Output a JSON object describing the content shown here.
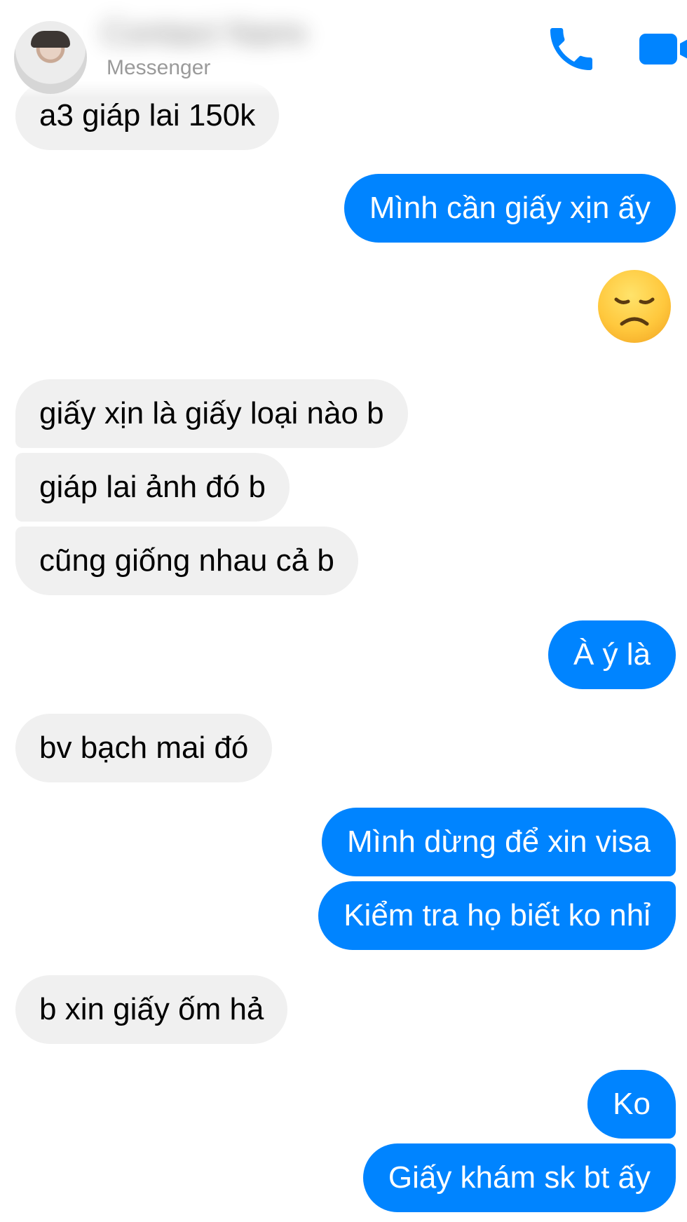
{
  "header": {
    "contact_name": "Contact Name",
    "subtitle": "Messenger",
    "icons": [
      "phone-icon",
      "video-camera-icon"
    ],
    "accent_color": "#0084ff"
  },
  "messages": [
    {
      "side": "in",
      "text": "a3 giáp lai 150k"
    },
    {
      "side": "out",
      "text": "Mình cần giấy xịn ấy"
    },
    {
      "side": "out",
      "emoji": "disappointed-face"
    },
    {
      "side": "in",
      "text": "giấy xịn là giấy loại nào b"
    },
    {
      "side": "in",
      "text": "giáp lai ảnh đó b"
    },
    {
      "side": "in",
      "text": "cũng giống nhau cả b"
    },
    {
      "side": "out",
      "text": "À ý là"
    },
    {
      "side": "in",
      "text": "bv bạch mai đó"
    },
    {
      "side": "out",
      "text": "Mình dừng để xin visa"
    },
    {
      "side": "out",
      "text": "Kiểm tra họ biết ko nhỉ"
    },
    {
      "side": "in",
      "text": "b xin giấy ốm hả"
    },
    {
      "side": "out",
      "text": "Ko"
    },
    {
      "side": "out",
      "text": "Giấy khám sk bt ấy"
    }
  ],
  "colors": {
    "incoming_bubble": "#f0f0f0",
    "outgoing_bubble": "#0084ff",
    "outgoing_text": "#ffffff"
  }
}
